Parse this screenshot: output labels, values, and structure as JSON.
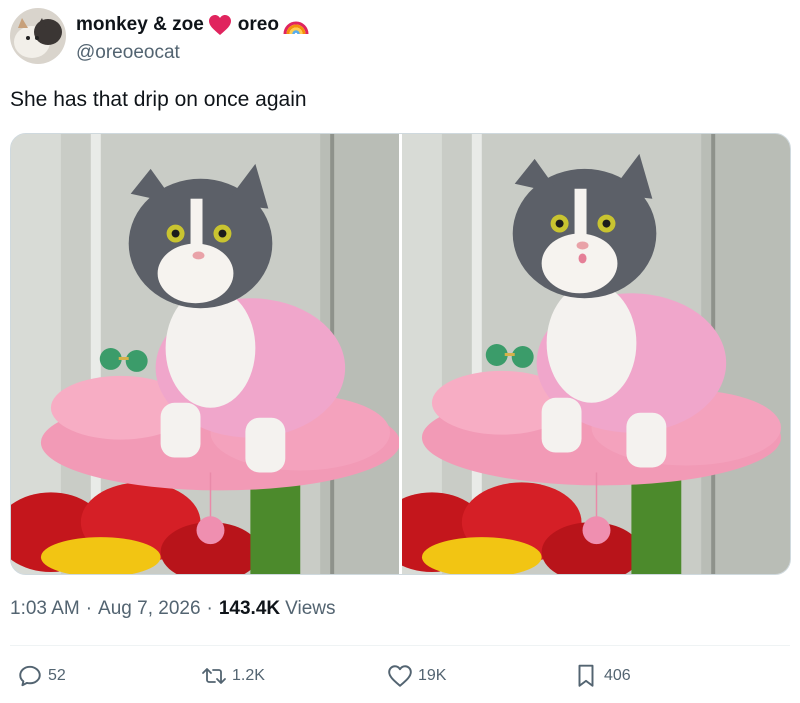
{
  "author": {
    "display_name_part1": "monkey & zoe",
    "display_name_part2": "oreo",
    "handle": "@oreoeocat"
  },
  "tweet": {
    "text": "She has that drip on once again"
  },
  "meta": {
    "time": "1:03 AM",
    "separator": "·",
    "date": "Aug 7, 2026",
    "views_count": "143.4K",
    "views_label": "Views"
  },
  "actions": {
    "replies": "52",
    "reposts": "1.2K",
    "likes": "19K",
    "bookmarks": "406"
  },
  "icons": {
    "heart": "heart-emoji",
    "rainbow": "rainbow-emoji",
    "reply": "reply-icon",
    "repost": "repost-icon",
    "like": "like-icon",
    "bookmark": "bookmark-icon"
  },
  "colors": {
    "text": "#0f1419",
    "secondary": "#536471",
    "heart": "#e0245e",
    "border": "#cfd9de"
  }
}
